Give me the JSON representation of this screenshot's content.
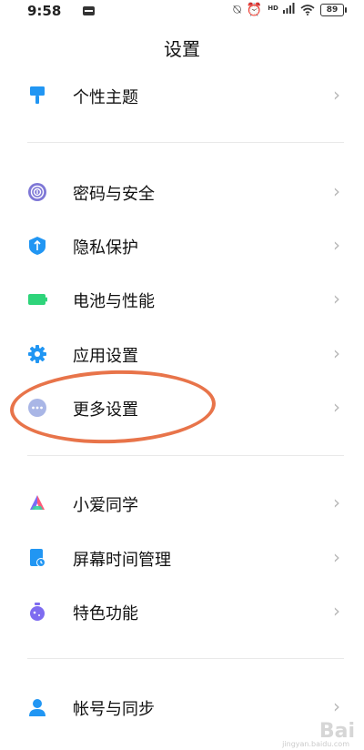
{
  "status_bar": {
    "time": "9:58",
    "battery": "89",
    "network": "HD"
  },
  "header": {
    "title": "设置"
  },
  "items": [
    {
      "label": "个性主题",
      "icon": "paint-brush-icon"
    },
    {
      "label": "密码与安全",
      "icon": "fingerprint-icon"
    },
    {
      "label": "隐私保护",
      "icon": "shield-icon"
    },
    {
      "label": "电池与性能",
      "icon": "battery-icon"
    },
    {
      "label": "应用设置",
      "icon": "gear-icon"
    },
    {
      "label": "更多设置",
      "icon": "more-dots-icon"
    },
    {
      "label": "小爱同学",
      "icon": "assistant-icon"
    },
    {
      "label": "屏幕时间管理",
      "icon": "screen-time-icon"
    },
    {
      "label": "特色功能",
      "icon": "flask-icon"
    },
    {
      "label": "帐号与同步",
      "icon": "account-icon"
    }
  ],
  "watermark": {
    "text": "Bai",
    "sub": "jingyan.baidu.com"
  },
  "colors": {
    "accent": "#2196f3",
    "highlight": "#e8744a",
    "battery_green": "#2ed47a"
  }
}
